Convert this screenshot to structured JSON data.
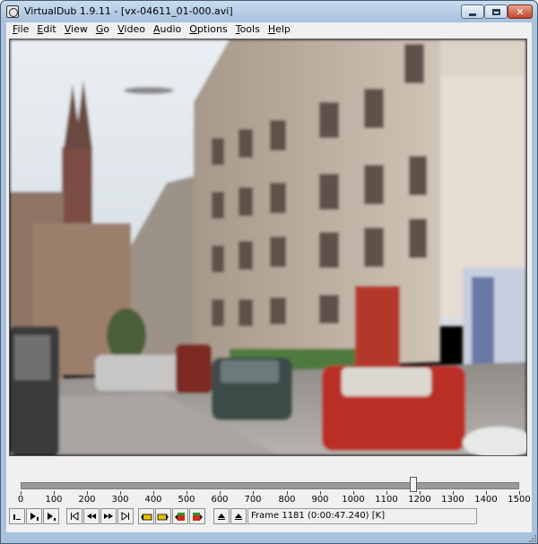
{
  "window": {
    "title": "VirtualDub 1.9.11 - [vx-04611_01-000.avi]",
    "close_glyph": "✕"
  },
  "menu": {
    "items": [
      "File",
      "Edit",
      "View",
      "Go",
      "Video",
      "Audio",
      "Options",
      "Tools",
      "Help"
    ]
  },
  "timeline": {
    "min": 0,
    "max": 1500,
    "current_frame": 1181,
    "tick_labels": [
      "0",
      "100",
      "200",
      "300",
      "400",
      "500",
      "600",
      "700",
      "800",
      "900",
      "1000",
      "1100",
      "1200",
      "1300",
      "1400",
      "1500"
    ]
  },
  "toolbar": {
    "buttons": [
      {
        "name": "stop-icon"
      },
      {
        "name": "play-input-icon"
      },
      {
        "name": "play-output-icon"
      },
      {
        "name": "go-to-start-icon"
      },
      {
        "name": "step-back-icon"
      },
      {
        "name": "step-forward-icon"
      },
      {
        "name": "go-to-end-icon"
      },
      {
        "name": "prev-keyframe-icon"
      },
      {
        "name": "next-keyframe-icon"
      },
      {
        "name": "prev-scene-icon"
      },
      {
        "name": "next-scene-icon"
      },
      {
        "name": "mark-in-icon"
      },
      {
        "name": "mark-out-icon"
      }
    ]
  },
  "status": {
    "text": "Frame 1181 (0:00:47.240) [K]"
  },
  "colors": {
    "title_bg": "#b5cce5",
    "close_button": "#c7462f",
    "accent_yellow": "#e8c200",
    "accent_red": "#d42a1a",
    "accent_green": "#2a9a2a"
  }
}
